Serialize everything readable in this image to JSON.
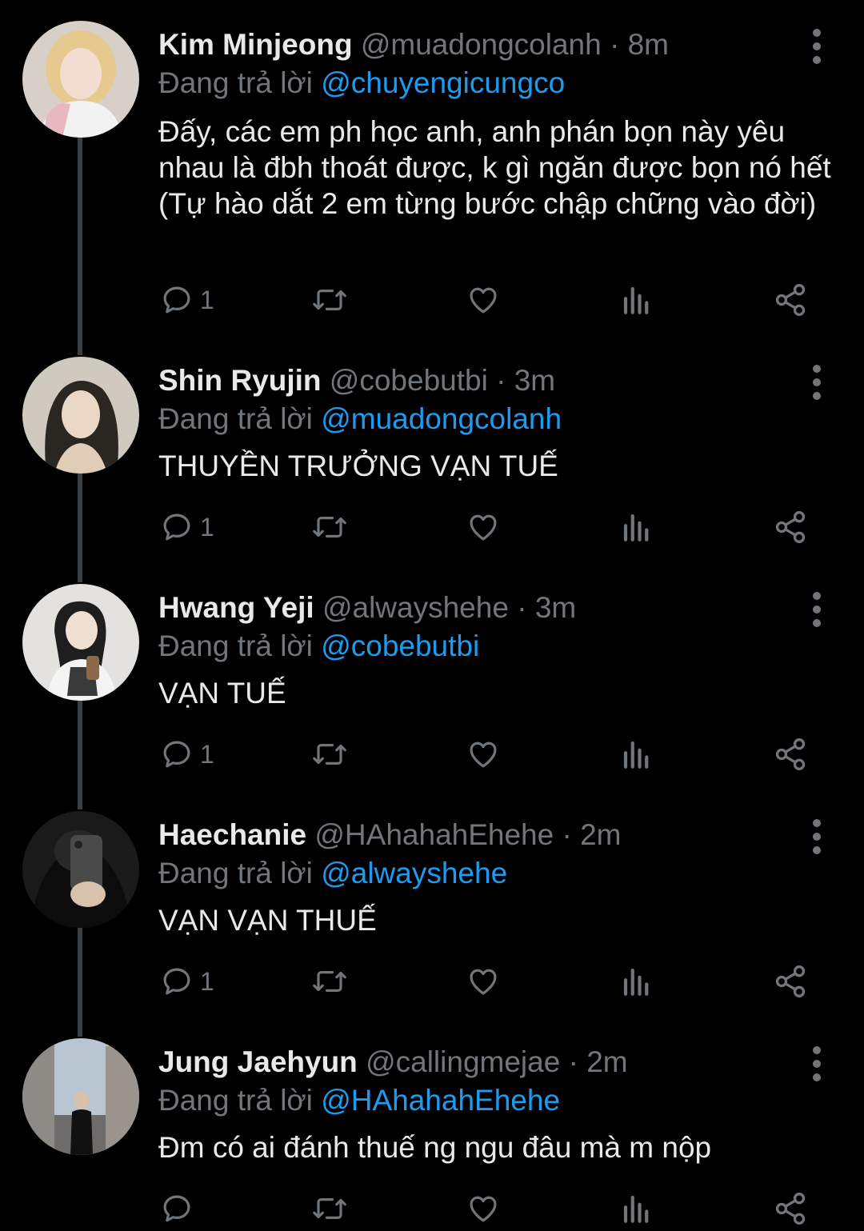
{
  "labels": {
    "replying_prefix": "Đang trả lời "
  },
  "colors": {
    "background": "#000000",
    "text": "#e7e9ea",
    "muted": "#71767b",
    "link": "#1d9bf0",
    "thread_line": "#3a3f44"
  },
  "tweets": [
    {
      "name": "Kim Minjeong",
      "handle": "@muadongcolanh",
      "separator": "·",
      "time": "8m",
      "reply_to": "@chuyengicungco",
      "text": "Đấy, các em ph học anh, anh phán bọn này yêu nhau là đbh thoát được, k gì ngăn được bọn nó hết (Tự hào dắt 2 em từng bước chập chững vào đời)",
      "reply_count": "1",
      "avatar_icon": "profile-photo"
    },
    {
      "name": "Shin Ryujin",
      "handle": "@cobebutbi",
      "separator": "·",
      "time": "3m",
      "reply_to": "@muadongcolanh",
      "text": "THUYỀN TRƯỞNG VẠN TUẾ",
      "reply_count": "1",
      "avatar_icon": "profile-photo"
    },
    {
      "name": "Hwang Yeji",
      "handle": "@alwayshehe",
      "separator": "·",
      "time": "3m",
      "reply_to": "@cobebutbi",
      "text": "VẠN TUẾ",
      "reply_count": "1",
      "avatar_icon": "profile-photo"
    },
    {
      "name": "Haechanie",
      "handle": "@HAhahahEhehe",
      "separator": "·",
      "time": "2m",
      "reply_to": "@alwayshehe",
      "text": "VẠN VẠN THUẾ",
      "reply_count": "1",
      "avatar_icon": "profile-photo"
    },
    {
      "name": "Jung Jaehyun",
      "handle": "@callingmejae",
      "separator": "·",
      "time": "2m",
      "reply_to": "@HAhahahEhehe",
      "text": "Đm có ai đánh thuế ng ngu đâu mà m nộp",
      "reply_count": "",
      "avatar_icon": "profile-photo"
    }
  ],
  "action_icons": [
    "reply-icon",
    "retweet-icon",
    "like-icon",
    "analytics-icon",
    "share-icon"
  ]
}
